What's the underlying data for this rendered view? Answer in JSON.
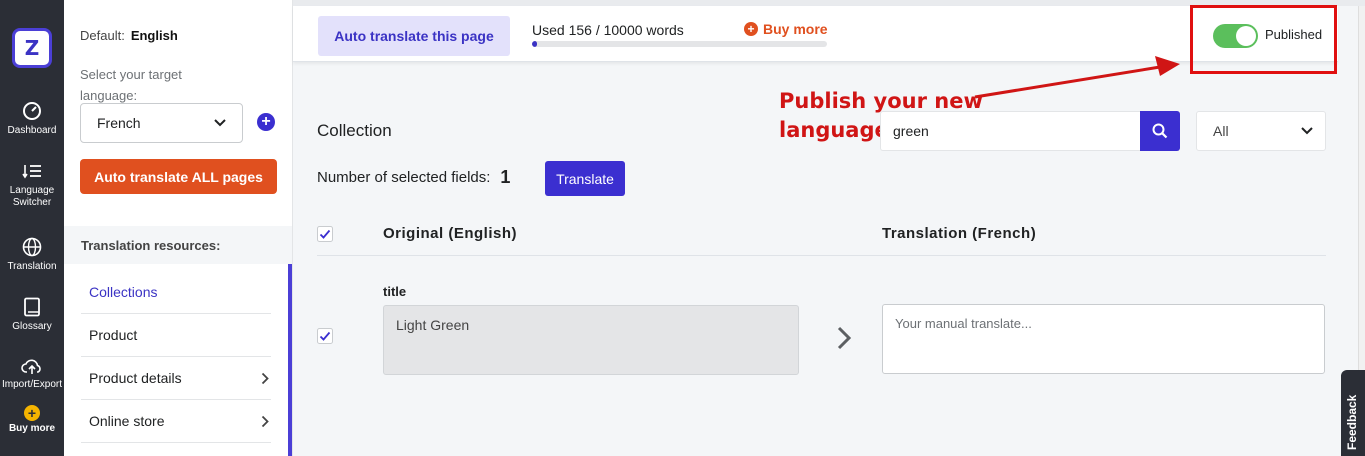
{
  "rail": {
    "items": [
      {
        "label": "Dashboard",
        "icon": "gauge-icon"
      },
      {
        "label": "Language Switcher",
        "icon": "list-icon"
      },
      {
        "label": "Translation",
        "icon": "globe-icon"
      },
      {
        "label": "Glossary",
        "icon": "book-icon"
      },
      {
        "label": "Import/Export",
        "icon": "cloud-upload-icon"
      },
      {
        "label": "Buy more",
        "icon": "plus-circle-icon"
      }
    ]
  },
  "sidebar": {
    "default_label": "Default:",
    "default_value": "English",
    "target_label": "Select your target language:",
    "language_selected": "French",
    "auto_all_label": "Auto translate ALL pages",
    "resources_heading": "Translation resources:",
    "resources": [
      {
        "label": "Collections",
        "active": true,
        "chevron": false
      },
      {
        "label": "Product",
        "active": false,
        "chevron": false
      },
      {
        "label": "Product details",
        "active": false,
        "chevron": true
      },
      {
        "label": "Online store",
        "active": false,
        "chevron": true
      }
    ]
  },
  "topbar": {
    "auto_page_label": "Auto translate this page",
    "usage_text": "Used 156 / 10000 words",
    "usage_fraction": 0.0156,
    "buy_more_label": "Buy more",
    "published_label": "Published",
    "published_on": true
  },
  "annotation": {
    "line1": "Publish your new",
    "line2": "language"
  },
  "main": {
    "section_title": "Collection",
    "search_value": "green",
    "filter_value": "All",
    "selected_fields_label": "Number of selected fields:",
    "selected_fields_count": "1",
    "translate_button": "Translate",
    "col_original": "Original (English)",
    "col_translation": "Translation (French)",
    "row": {
      "field_label": "title",
      "original_value": "Light Green",
      "translation_placeholder": "Your manual translate..."
    }
  },
  "feedback_label": "Feedback",
  "colors": {
    "accent": "#3b2fd0",
    "orange": "#e0501f",
    "annotation_red": "#d01515",
    "toggle_green": "#5bbf5c",
    "rail_bg": "#2b2e36"
  }
}
